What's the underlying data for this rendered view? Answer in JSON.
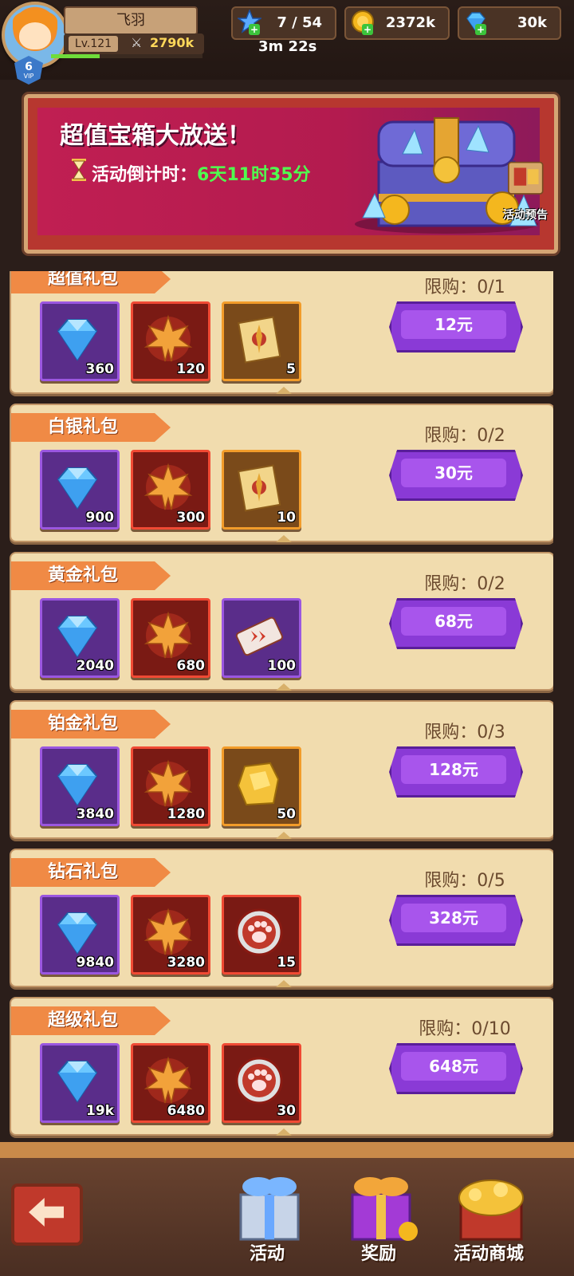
{
  "player": {
    "name": "飞羽",
    "level": "Lv.121",
    "power": "2790k",
    "vip": "6",
    "vip_label": "VIP",
    "xp_fraction": 0.32
  },
  "resources": {
    "stars": "7 / 54",
    "coins": "2372k",
    "gems": "30k",
    "timer": "3m 22s"
  },
  "banner": {
    "title": "超值宝箱大放送！",
    "countdown_label": "活动倒计时：",
    "countdown_value": "6天11时35分",
    "preview_label": "活动预告"
  },
  "packs": [
    {
      "title": "超值礼包",
      "limit": "限购：0/1",
      "price": "12元",
      "items": [
        {
          "kind": "gem",
          "qty": "360"
        },
        {
          "kind": "leaf",
          "qty": "120"
        },
        {
          "kind": "book",
          "qty": "5"
        }
      ]
    },
    {
      "title": "白银礼包",
      "limit": "限购：0/2",
      "price": "30元",
      "items": [
        {
          "kind": "gem",
          "qty": "900"
        },
        {
          "kind": "leaf",
          "qty": "300"
        },
        {
          "kind": "book",
          "qty": "10"
        }
      ]
    },
    {
      "title": "黄金礼包",
      "limit": "限购：0/2",
      "price": "68元",
      "items": [
        {
          "kind": "gem",
          "qty": "2040"
        },
        {
          "kind": "leaf",
          "qty": "680"
        },
        {
          "kind": "ticket",
          "qty": "100"
        }
      ]
    },
    {
      "title": "铂金礼包",
      "limit": "限购：0/3",
      "price": "128元",
      "items": [
        {
          "kind": "gem",
          "qty": "3840"
        },
        {
          "kind": "leaf",
          "qty": "1280"
        },
        {
          "kind": "gold",
          "qty": "50"
        }
      ]
    },
    {
      "title": "钻石礼包",
      "limit": "限购：0/5",
      "price": "328元",
      "items": [
        {
          "kind": "gem",
          "qty": "9840"
        },
        {
          "kind": "leaf",
          "qty": "3280"
        },
        {
          "kind": "paw",
          "qty": "15"
        }
      ]
    },
    {
      "title": "超级礼包",
      "limit": "限购：0/10",
      "price": "648元",
      "items": [
        {
          "kind": "gem",
          "qty": "19k"
        },
        {
          "kind": "leaf",
          "qty": "6480"
        },
        {
          "kind": "paw",
          "qty": "30"
        }
      ]
    }
  ],
  "nav": {
    "tab1": "活动",
    "tab2": "奖励",
    "tab3": "活动商城"
  }
}
